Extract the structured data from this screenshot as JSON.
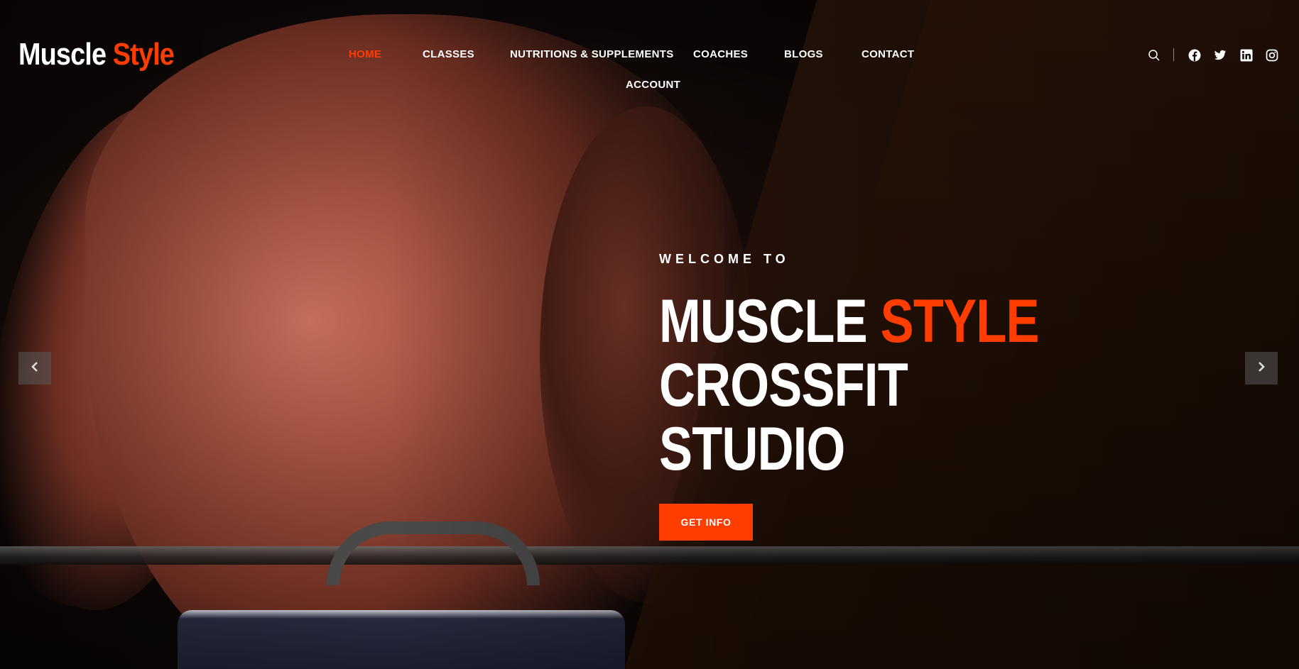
{
  "brand": {
    "name_primary": "Muscle",
    "name_accent": "Style",
    "accent_color": "#ff3d00"
  },
  "nav": {
    "items": [
      {
        "label": "HOME",
        "active": true
      },
      {
        "label": "CLASSES",
        "active": false
      },
      {
        "label": "NUTRITIONS & SUPPLEMENTS",
        "active": false
      },
      {
        "label": "COACHES",
        "active": false
      },
      {
        "label": "BLOGS",
        "active": false
      },
      {
        "label": "CONTACT",
        "active": false
      },
      {
        "label": "ACCOUNT",
        "active": false
      }
    ]
  },
  "header_tools": {
    "icons": [
      "search-icon",
      "facebook-icon",
      "twitter-icon",
      "linkedin-icon",
      "instagram-icon"
    ]
  },
  "hero": {
    "eyebrow": "WELCOME TO",
    "headline_line1_white": "MUSCLE",
    "headline_line1_accent": "STYLE",
    "headline_line2": "CROSSFIT",
    "headline_line3": "STUDIO",
    "cta_label": "GET INFO"
  },
  "slider": {
    "prev_icon": "chevron-left-icon",
    "next_icon": "chevron-right-icon"
  }
}
